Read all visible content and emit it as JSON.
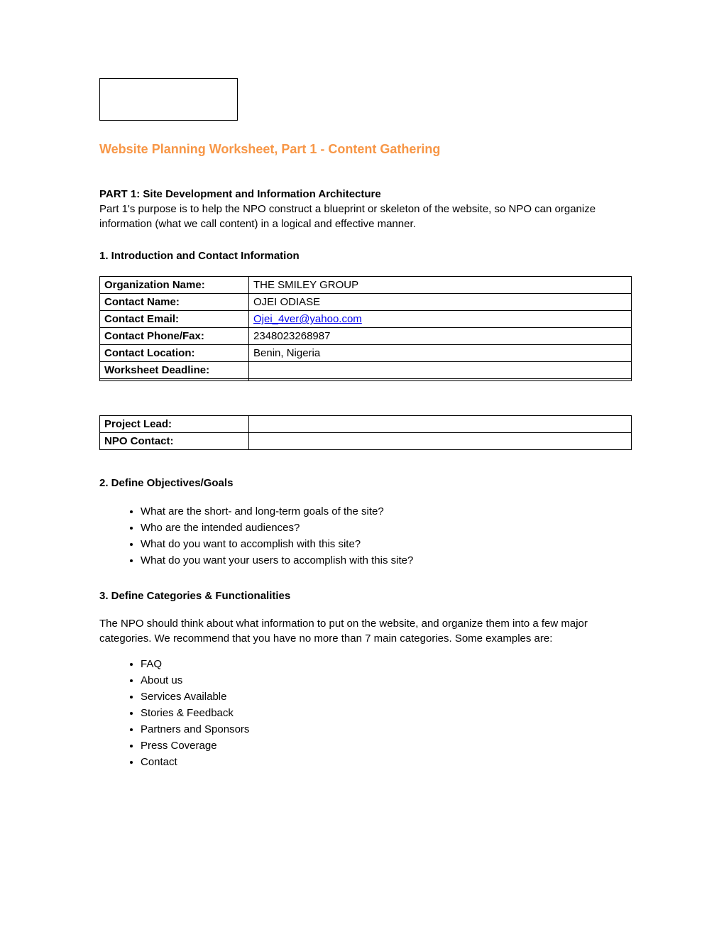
{
  "title": "Website Planning Worksheet, Part 1 - Content Gathering",
  "part1": {
    "heading": "PART 1: Site Development and Information Architecture",
    "text": "Part 1's purpose is to help the NPO construct a blueprint or skeleton of the website, so NPO can organize information (what we call content) in a logical and effective manner."
  },
  "section1": {
    "heading": "1. Introduction and Contact Information",
    "rows": [
      {
        "label": "Organization Name:",
        "value": "THE SMILEY GROUP"
      },
      {
        "label": "Contact Name:",
        "value": "OJEI ODIASE"
      },
      {
        "label": "Contact Email:",
        "value": "Ojei_4ver@yahoo.com",
        "is_email": true
      },
      {
        "label": "Contact Phone/Fax:",
        "value": "2348023268987"
      },
      {
        "label": "Contact Location:",
        "value": "Benin, Nigeria"
      },
      {
        "label": "Worksheet Deadline:",
        "value": ""
      },
      {
        "label": "",
        "value": ""
      }
    ],
    "rows2": [
      {
        "label": "Project Lead:",
        "value": ""
      },
      {
        "label": "NPO Contact:",
        "value": ""
      }
    ]
  },
  "section2": {
    "heading": "2. Define Objectives/Goals",
    "items": [
      "What are the short- and long-term goals of the site?",
      "Who are the intended audiences?",
      "What do you want to accomplish with this site?",
      "What do you want your users to accomplish with this site?"
    ]
  },
  "section3": {
    "heading": "3. Define Categories & Functionalities",
    "text": "The NPO should think about what information to put on the website, and organize them into a few major categories. We recommend that you have no more than 7 main categories. Some examples are:",
    "items": [
      "FAQ",
      "About us",
      "Services Available",
      "Stories & Feedback",
      "Partners and Sponsors",
      "Press Coverage",
      "Contact"
    ]
  }
}
